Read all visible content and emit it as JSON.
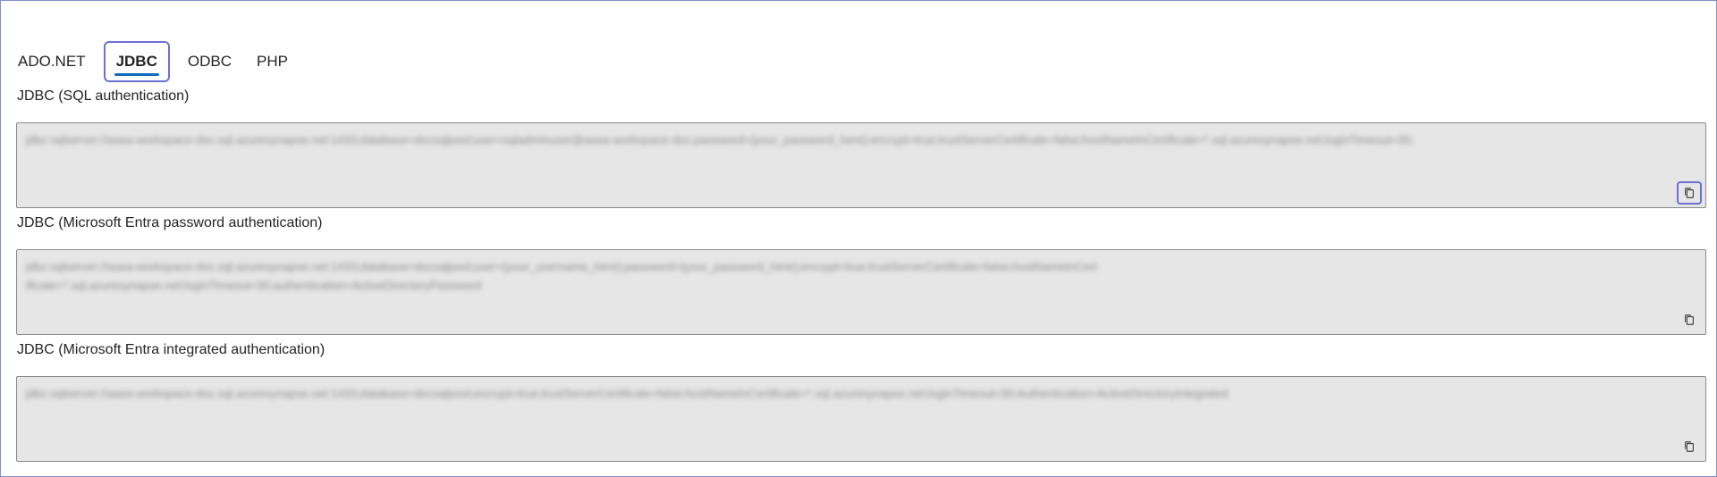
{
  "tabs": [
    {
      "label": "ADO.NET",
      "active": false
    },
    {
      "label": "JDBC",
      "active": true
    },
    {
      "label": "ODBC",
      "active": false
    },
    {
      "label": "PHP",
      "active": false
    }
  ],
  "sections": [
    {
      "label": "JDBC (SQL authentication)",
      "connection_string": "jdbc:sqlserver://asea-workspace-doc.sql.azuresynapse.net:1433;database=docsqlpool;user=sqladminuser@asea-workspace-doc;password={your_password_here};encrypt=true;trustServerCertificate=false;hostNameInCertificate=*.sql.azuresynapse.net;loginTimeout=30;",
      "copy_icon": "copy-icon"
    },
    {
      "label": "JDBC (Microsoft Entra password authentication)",
      "connection_string": "jdbc:sqlserver://asea-workspace-doc.sql.azuresynapse.net:1433;database=docsqlpool;user={your_username_here};password={your_password_here};encrypt=true;trustServerCertificate=false;hostNameInCertificate=*.sql.azuresynapse.net;loginTimeout=30;authentication=ActiveDirectoryPassword",
      "copy_icon": "copy-icon"
    },
    {
      "label": "JDBC (Microsoft Entra integrated authentication)",
      "connection_string": "jdbc:sqlserver://asea-workspace-doc.sql.azuresynapse.net:1433;database=docsqlpool;encrypt=true;trustServerCertificate=false;hostNameInCertificate=*.sql.azuresynapse.net;loginTimeout=30;Authentication=ActiveDirectoryIntegrated",
      "copy_icon": "copy-icon"
    }
  ],
  "colors": {
    "focus_outline": "#6b6fd6",
    "tab_underline": "#0f6cbd",
    "codebox_bg": "#e6e6e6"
  }
}
